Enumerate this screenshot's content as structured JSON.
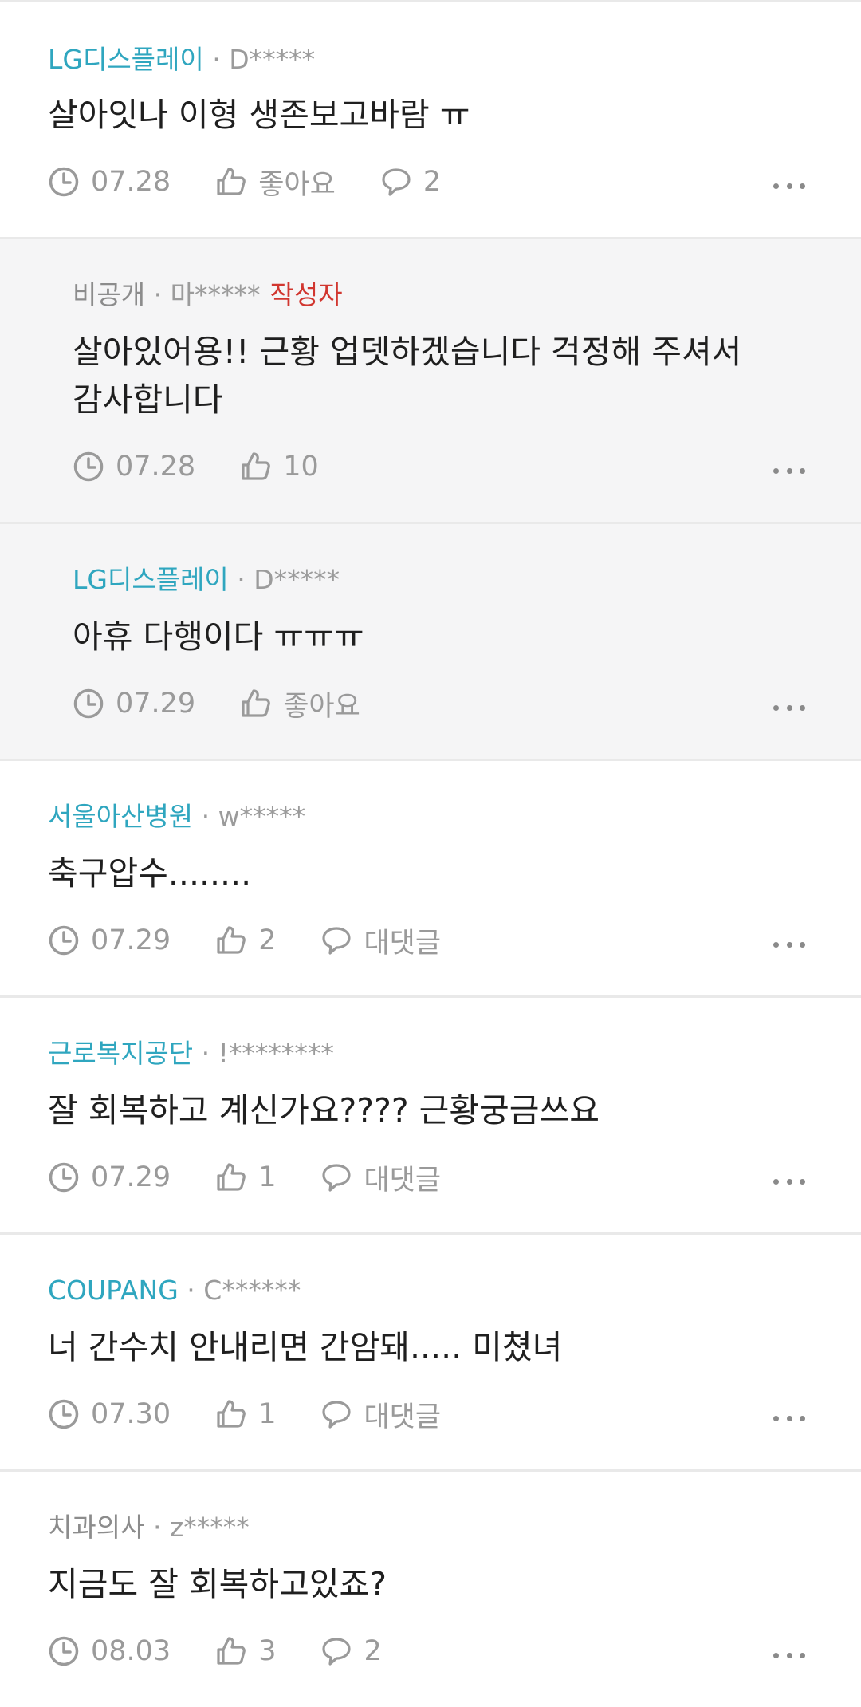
{
  "comments": [
    {
      "company": "LG디스플레이",
      "user": "D*****",
      "text": "살아잇나 이형 생존보고바람 ㅠ",
      "date": "07.28",
      "like": "좋아요",
      "reply": "2"
    },
    {
      "company": "비공개",
      "user": "마*****",
      "author_tag": "작성자",
      "text": "살아있어용!! 근황 업뎃하겠습니다 걱정해 주셔서 감사합니다",
      "date": "07.28",
      "like": "10"
    },
    {
      "company": "LG디스플레이",
      "user": "D*****",
      "text": "아휴 다행이다 ㅠㅠㅠ",
      "date": "07.29",
      "like": "좋아요"
    },
    {
      "company": "서울아산병원",
      "user": "w*****",
      "text": "축구압수........",
      "date": "07.29",
      "like": "2",
      "reply": "대댓글"
    },
    {
      "company": "근로복지공단",
      "user": "!********",
      "text": "잘 회복하고 계신가요???? 근황궁금쓰요",
      "date": "07.29",
      "like": "1",
      "reply": "대댓글"
    },
    {
      "company": "COUPANG",
      "user": "C******",
      "text": "너 간수치 안내리면 간암돼..... 미쳤녀",
      "date": "07.30",
      "like": "1",
      "reply": "대댓글"
    },
    {
      "company": "치과의사",
      "user": "z*****",
      "text": "지금도 잘 회복하고있죠?",
      "date": "08.03",
      "like": "3",
      "reply": "2"
    }
  ],
  "colors": {
    "company": "#2fa6bf",
    "muted": "#9b9b9b",
    "author_tag": "#d1362f",
    "reply_bg": "#f5f5f6",
    "divider": "#e9e9e9"
  },
  "icons": {
    "date": "clock-icon",
    "like": "thumbs-up-icon",
    "reply": "speech-bubble-icon",
    "more": "more-options-icon"
  },
  "separator": "·"
}
